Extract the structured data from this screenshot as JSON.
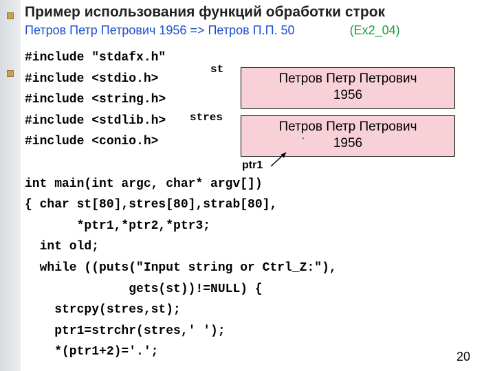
{
  "title": "Пример использования функций обработки строк",
  "subtitle_left": "Петров Петр Петрович 1956 => Петров П.П. 50",
  "subtitle_ref": "(Ex2_04)",
  "code": "#include \"stdafx.h\"\n#include <stdio.h>\n#include <string.h>\n#include <stdlib.h>\n#include <conio.h>\n\nint main(int argc, char* argv[])\n{ char st[80],stres[80],strab[80],\n       *ptr1,*ptr2,*ptr3;\n  int old;\n  while ((puts(\"Input string or Ctrl_Z:\"),\n              gets(st))!=NULL) {\n    strcpy(stres,st);\n    ptr1=strchr(stres,' ');\n    *(ptr1+2)='.';",
  "label_st": "st",
  "label_stres": "stres",
  "label_ptr1": "ptr1",
  "box1_l1": "Петров  Петр  Петрович",
  "box1_l2": "1956",
  "box2_l1": "Петров  Петр  Петрович",
  "box2_l2": "1956",
  "box2_dot": ".",
  "page": "20"
}
